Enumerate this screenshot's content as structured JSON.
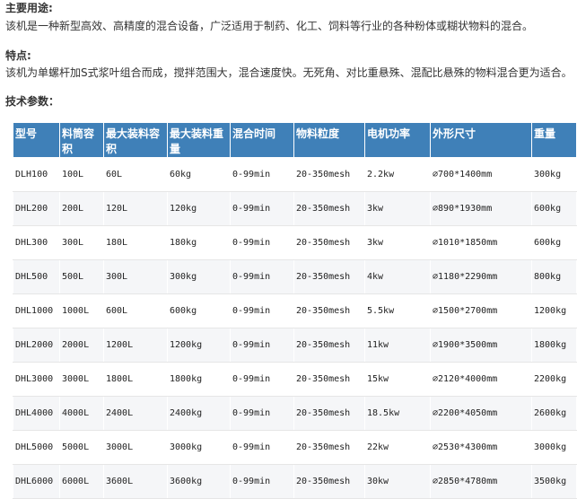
{
  "sections": {
    "usage_title": "主要用途:",
    "usage_text": "该机是一种新型高效、高精度的混合设备，广泛适用于制药、化工、饲料等行业的各种粉体或糊状物料的混合。",
    "features_title": "特点:",
    "features_text": "该机为单螺杆加S式浆叶组合而成，搅拌范围大，混合速度快。无死角、对比重悬殊、混配比悬殊的物料混合更为适合。",
    "specs_title": "技术参数："
  },
  "table": {
    "headers": [
      "型号",
      "料筒容积",
      "最大装料容积",
      "最大装料重量",
      "混合时间",
      "物料粒度",
      "电机功率",
      "外形尺寸",
      "重量"
    ],
    "rows": [
      [
        "DLH100",
        "100L",
        "60L",
        "60kg",
        "0-99min",
        "20-350mesh",
        "2.2kw",
        "∅700*1400mm",
        "300kg"
      ],
      [
        "DHL200",
        "200L",
        "120L",
        "120kg",
        "0-99min",
        "20-350mesh",
        "3kw",
        "∅890*1930mm",
        "600kg"
      ],
      [
        "DHL300",
        "300L",
        "180L",
        "180kg",
        "0-99min",
        "20-350mesh",
        "3kw",
        "∅1010*1850mm",
        "600kg"
      ],
      [
        "DHL500",
        "500L",
        "300L",
        "300kg",
        "0-99min",
        "20-350mesh",
        "4kw",
        "∅1180*2290mm",
        "800kg"
      ],
      [
        "DHL1000",
        "1000L",
        "600L",
        "600kg",
        "0-99min",
        "20-350mesh",
        "5.5kw",
        "∅1500*2700mm",
        "1200kg"
      ],
      [
        "DHL2000",
        "2000L",
        "1200L",
        "1200kg",
        "0-99min",
        "20-350mesh",
        "11kw",
        "∅1900*3500mm",
        "1800kg"
      ],
      [
        "DHL3000",
        "3000L",
        "1800L",
        "1800kg",
        "0-99min",
        "20-350mesh",
        "15kw",
        "∅2120*4000mm",
        "2200kg"
      ],
      [
        "DHL4000",
        "4000L",
        "2400L",
        "2400kg",
        "0-99min",
        "20-350mesh",
        "18.5kw",
        "∅2200*4050mm",
        "2600kg"
      ],
      [
        "DHL5000",
        "5000L",
        "3000L",
        "3000kg",
        "0-99min",
        "20-350mesh",
        "22kw",
        "∅2530*4300mm",
        "3000kg"
      ],
      [
        "DHL6000",
        "6000L",
        "3600L",
        "3600kg",
        "0-99min",
        "20-350mesh",
        "30kw",
        "∅2850*4780mm",
        "3500kg"
      ]
    ]
  },
  "colors": {
    "header_bg": "#3f80b8",
    "header_text": "#ffffff",
    "row_alt": "#f5f6f8"
  }
}
